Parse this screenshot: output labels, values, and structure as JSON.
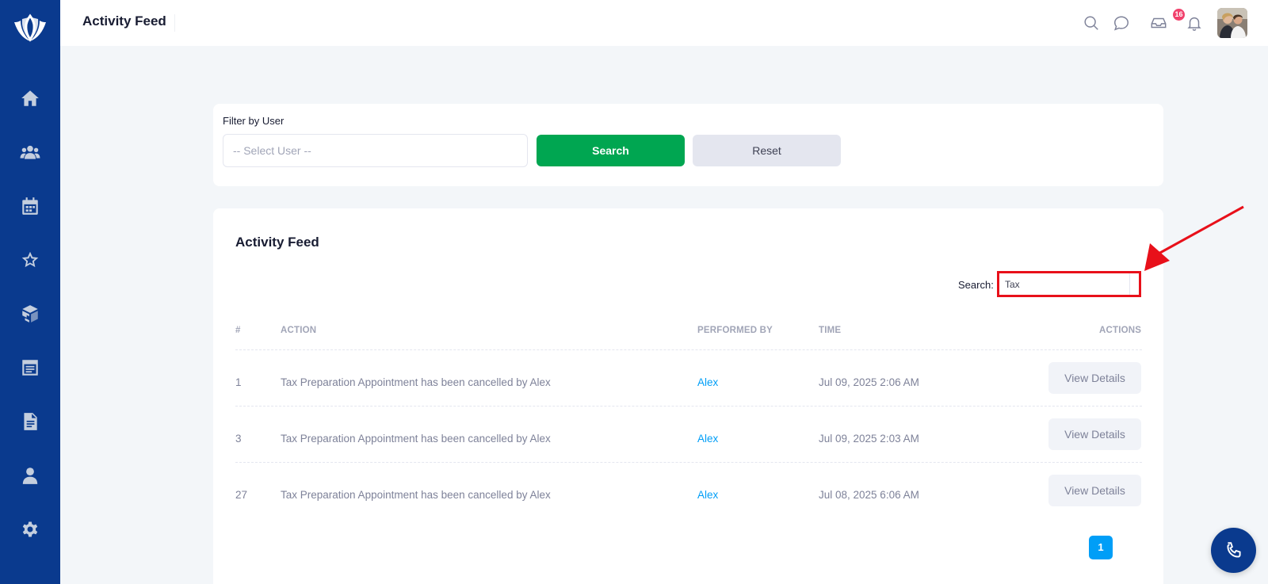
{
  "header": {
    "title": "Activity Feed",
    "notification_count": "16"
  },
  "sidebar": {
    "items": [
      {
        "icon": "home-icon"
      },
      {
        "icon": "users-icon"
      },
      {
        "icon": "calendar-icon"
      },
      {
        "icon": "star-icon"
      },
      {
        "icon": "package-icon"
      },
      {
        "icon": "browser-icon"
      },
      {
        "icon": "document-icon"
      },
      {
        "icon": "user-icon"
      },
      {
        "icon": "gear-icon"
      }
    ]
  },
  "filter": {
    "label": "Filter by User",
    "select_placeholder": "-- Select User --",
    "search_label": "Search",
    "reset_label": "Reset"
  },
  "feed": {
    "title": "Activity Feed",
    "search_label": "Search:",
    "search_value": "Tax",
    "columns": [
      "#",
      "ACTION",
      "PERFORMED BY",
      "TIME",
      "ACTIONS"
    ],
    "rows": [
      {
        "id": "1",
        "action": "Tax Preparation Appointment has been cancelled by Alex",
        "performed_by": "Alex",
        "time": "Jul 09, 2025 2:06 AM",
        "button": "View Details"
      },
      {
        "id": "3",
        "action": "Tax Preparation Appointment has been cancelled by Alex",
        "performed_by": "Alex",
        "time": "Jul 09, 2025 2:03 AM",
        "button": "View Details"
      },
      {
        "id": "27",
        "action": "Tax Preparation Appointment has been cancelled by Alex",
        "performed_by": "Alex",
        "time": "Jul 08, 2025 6:06 AM",
        "button": "View Details"
      }
    ],
    "current_page": "1"
  },
  "colors": {
    "sidebar": "#0a3a8e",
    "primary_green": "#00a651",
    "link_blue": "#009ef7",
    "highlight_red": "#e8101a"
  }
}
